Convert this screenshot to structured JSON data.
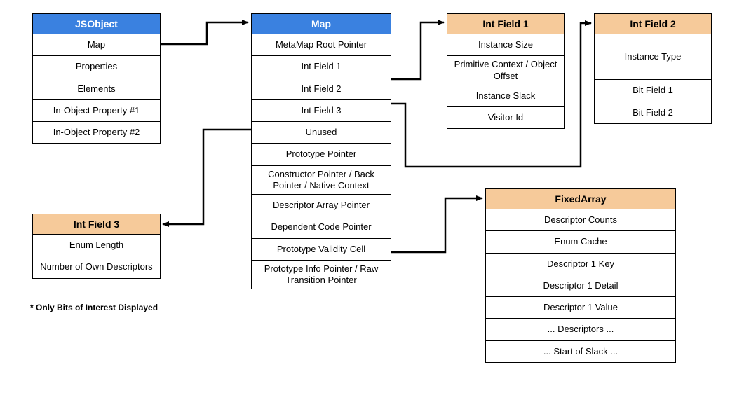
{
  "jsobject": {
    "title": "JSObject",
    "rows": [
      "Map",
      "Properties",
      "Elements",
      "In-Object Property #1",
      "In-Object Property #2"
    ]
  },
  "map": {
    "title": "Map",
    "rows": [
      "MetaMap Root Pointer",
      "Int Field 1",
      "Int Field 2",
      "Int Field 3",
      "Unused",
      "Prototype Pointer",
      "Constructor Pointer / Back Pointer / Native Context",
      "Descriptor Array Pointer",
      "Dependent Code Pointer",
      "Prototype Validity Cell",
      "Prototype Info Pointer / Raw Transition Pointer"
    ]
  },
  "intfield1": {
    "title": "Int Field 1",
    "rows": [
      "Instance Size",
      "Primitive Context / Object Offset",
      "Instance Slack",
      "Visitor Id"
    ]
  },
  "intfield2": {
    "title": "Int Field 2",
    "rows": [
      "Instance Type",
      "Bit Field 1",
      "Bit Field 2"
    ]
  },
  "intfield3": {
    "title": "Int Field 3",
    "rows": [
      "Enum Length",
      "Number of Own Descriptors"
    ]
  },
  "fixedarray": {
    "title": "FixedArray",
    "rows": [
      "Descriptor Counts",
      "Enum Cache",
      "Descriptor 1 Key",
      "Descriptor 1 Detail",
      "Descriptor 1 Value",
      "... Descriptors ...",
      "... Start of Slack ..."
    ]
  },
  "footnote": "* Only Bits of Interest Displayed"
}
